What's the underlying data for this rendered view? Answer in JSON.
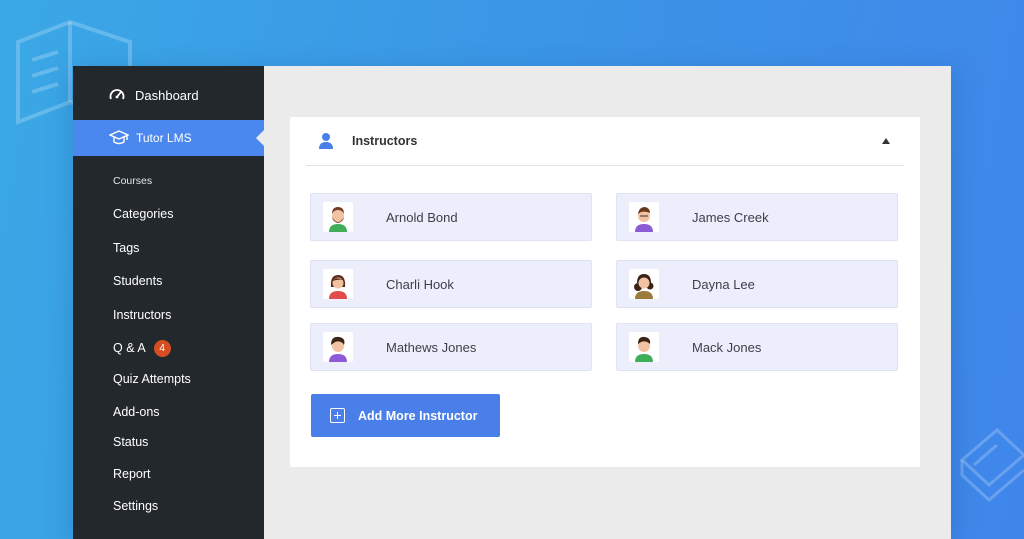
{
  "sidebar": {
    "top_item": {
      "label": "Dashboard",
      "icon": "gauge-icon"
    },
    "active_item": {
      "label": "Tutor LMS",
      "icon": "graduation-cap-icon"
    },
    "items": [
      {
        "label": "Courses"
      },
      {
        "label": "Categories"
      },
      {
        "label": "Tags"
      },
      {
        "label": "Students"
      },
      {
        "label": "Instructors"
      },
      {
        "label": "Q & A",
        "badge": "4"
      },
      {
        "label": "Quiz Attempts"
      },
      {
        "label": "Add-ons"
      },
      {
        "label": "Status"
      },
      {
        "label": "Report"
      },
      {
        "label": "Settings"
      }
    ]
  },
  "panel": {
    "title": "Instructors",
    "icon": "user-icon",
    "collapse_icon": "caret-up-icon",
    "instructors": [
      {
        "name": "Arnold Bond",
        "avatar": "avatar-bearded-man-icon"
      },
      {
        "name": "James Creek",
        "avatar": "avatar-man-purple-shirt-icon"
      },
      {
        "name": "Charli Hook",
        "avatar": "avatar-woman-red-shirt-icon"
      },
      {
        "name": "Dayna Lee",
        "avatar": "avatar-woman-curly-hair-icon"
      },
      {
        "name": "Mathews Jones",
        "avatar": "avatar-man-purple-shirt-icon"
      },
      {
        "name": "Mack Jones",
        "avatar": "avatar-man-green-shirt-icon"
      }
    ],
    "add_button_label": "Add More Instructor"
  },
  "colors": {
    "sidebar_bg": "#23282d",
    "accent": "#4a87ee",
    "badge": "#d54e21",
    "instructor_bg": "#eceefb"
  }
}
